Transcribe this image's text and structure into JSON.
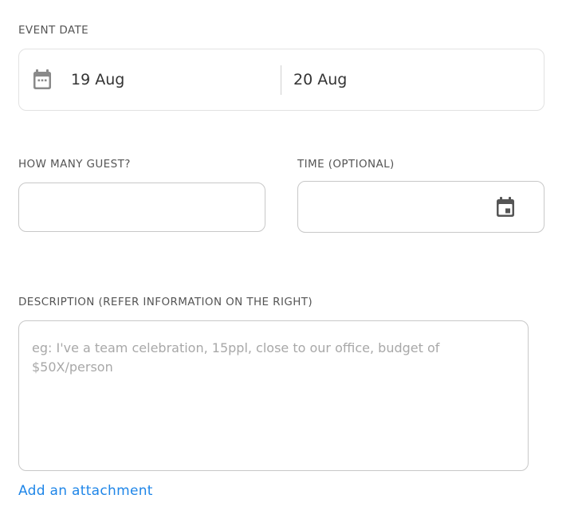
{
  "event_date": {
    "label": "EVENT DATE",
    "start_date": "19 Aug",
    "end_date": "20 Aug",
    "icon": "calendar-icon"
  },
  "guests": {
    "label": "HOW MANY GUEST?",
    "value": ""
  },
  "time": {
    "label": "TIME (OPTIONAL)",
    "value": "",
    "icon": "calendar-event-icon"
  },
  "description": {
    "label": "DESCRIPTION (REFER INFORMATION ON THE RIGHT)",
    "placeholder": "eg: I've a team celebration, 15ppl, close to our office, budget of $50X/person",
    "value": ""
  },
  "attachment": {
    "link_label": "Add an attachment",
    "color": "#1f86e8"
  }
}
